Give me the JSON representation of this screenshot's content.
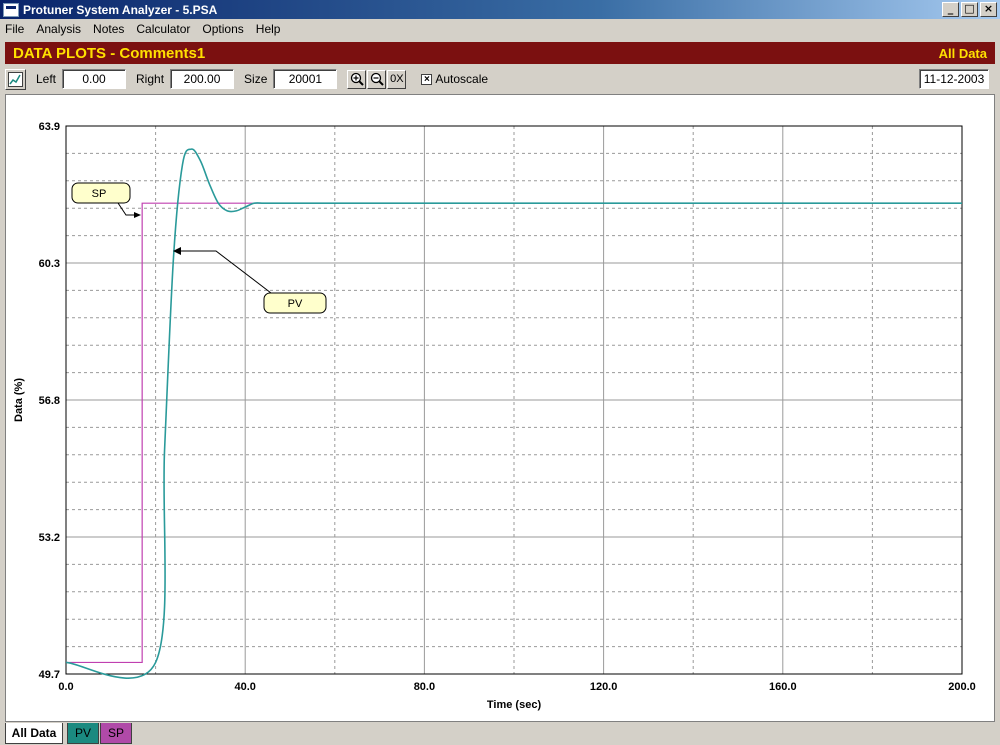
{
  "window": {
    "title": "Protuner System Analyzer - 5.PSA"
  },
  "menu": [
    "File",
    "Analysis",
    "Notes",
    "Calculator",
    "Options",
    "Help"
  ],
  "header": {
    "title": "DATA PLOTS - Comments1",
    "view": "All Data"
  },
  "toolbar": {
    "left_label": "Left",
    "left_value": "0.00",
    "right_label": "Right",
    "right_value": "200.00",
    "size_label": "Size",
    "size_value": "20001",
    "zoom_in": "+",
    "zoom_out": "−",
    "zoom_reset": "0X",
    "autoscale_label": "Autoscale",
    "autoscale_checked": "×",
    "date": "11-12-2003"
  },
  "colors": {
    "pv": "#2a9a9a",
    "sp": "#c040b0",
    "header_bg": "#7b1010",
    "header_text": "#ffe000"
  },
  "chart_data": {
    "type": "line",
    "xlabel": "Time (sec)",
    "ylabel": "Data (%)",
    "xlim": [
      0,
      200
    ],
    "ylim": [
      49.7,
      63.9
    ],
    "x_ticks": [
      "0.0",
      "40.0",
      "80.0",
      "120.0",
      "160.0",
      "200.0"
    ],
    "y_ticks": [
      "49.7",
      "53.2",
      "56.8",
      "60.3",
      "63.9"
    ],
    "grid": true,
    "series": [
      {
        "name": "SP",
        "color": "#c040b0",
        "x": [
          0,
          17,
          17,
          200
        ],
        "y": [
          50.0,
          50.0,
          61.9,
          61.9
        ]
      },
      {
        "name": "PV",
        "color": "#2a9a9a",
        "x": [
          0,
          20,
          22,
          24,
          26,
          28,
          30,
          32,
          34,
          36,
          38,
          40,
          42,
          44,
          46,
          60,
          80,
          100,
          120,
          200
        ],
        "y": [
          50.0,
          50.0,
          55.5,
          60.5,
          62.9,
          63.3,
          63.0,
          62.4,
          61.9,
          61.7,
          61.7,
          61.8,
          61.9,
          61.9,
          61.9,
          61.9,
          61.9,
          61.9,
          61.9,
          61.9
        ]
      }
    ],
    "annotations": [
      {
        "text": "SP",
        "series": "SP"
      },
      {
        "text": "PV",
        "series": "PV"
      }
    ]
  },
  "tabs": [
    "All Data",
    "PV",
    "SP"
  ]
}
